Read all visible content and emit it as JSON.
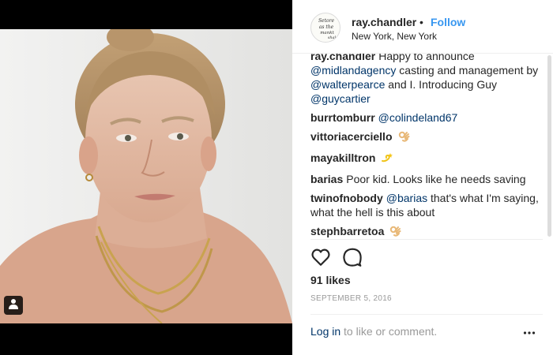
{
  "header": {
    "username": "ray.chandler",
    "dot": "•",
    "follow_label": "Follow",
    "location": "New York, New York",
    "avatar_text": "Setore as the mankt shal"
  },
  "comments": [
    {
      "user": "ray.chandler",
      "parts": [
        {
          "t": "text",
          "v": "Happy to announce "
        },
        {
          "t": "mention",
          "v": "@midlandagency"
        },
        {
          "t": "text",
          "v": " casting and management by "
        },
        {
          "t": "mention",
          "v": "@walterpearce"
        },
        {
          "t": "text",
          "v": " and I. Introducing Guy "
        },
        {
          "t": "mention",
          "v": "@guycartier"
        }
      ]
    },
    {
      "user": "burrtomburr",
      "parts": [
        {
          "t": "mention",
          "v": "@colindeland67"
        }
      ]
    },
    {
      "user": "vittoriacerciello",
      "parts": [
        {
          "t": "emoji",
          "v": "ok-hand-emoji"
        }
      ]
    },
    {
      "user": "mayakilltron",
      "parts": [
        {
          "t": "emoji",
          "v": "dizzy-emoji"
        }
      ]
    },
    {
      "user": "barias",
      "parts": [
        {
          "t": "text",
          "v": "Poor kid. Looks like he needs saving"
        }
      ]
    },
    {
      "user": "twinofnobody",
      "parts": [
        {
          "t": "mention",
          "v": "@barias"
        },
        {
          "t": "text",
          "v": " that's what I'm saying, what the hell is this about"
        }
      ]
    },
    {
      "user": "stephbarretoa",
      "parts": [
        {
          "t": "emoji",
          "v": "ok-hand-emoji"
        }
      ]
    }
  ],
  "actions": {
    "like_icon": "heart-outline-icon",
    "comment_icon": "comment-bubble-icon"
  },
  "likes_text": "91 likes",
  "date_text": "SEPTEMBER 5, 2016",
  "footer": {
    "login_label": "Log in",
    "login_rest": " to like or comment.",
    "more_icon": "more-options-icon"
  },
  "colors": {
    "accent": "#3897f0",
    "mention": "#003569",
    "muted": "#999999",
    "text": "#262626"
  }
}
